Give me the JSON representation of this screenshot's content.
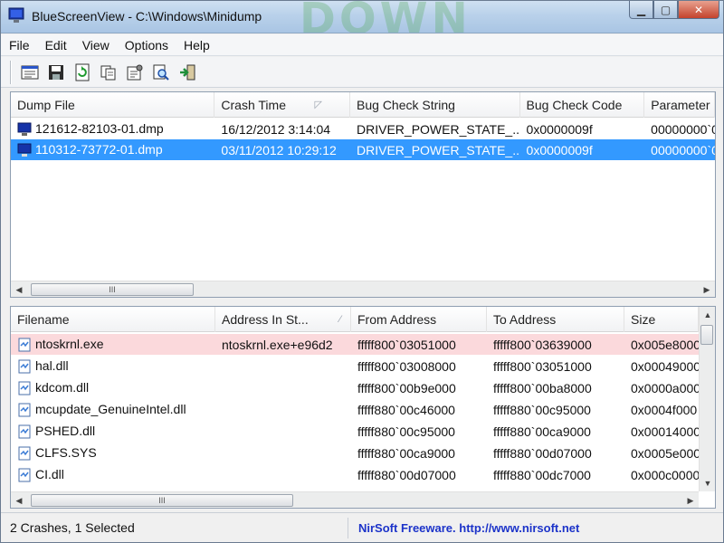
{
  "window": {
    "title": "BlueScreenView  -  C:\\Windows\\Minidump",
    "title_bg_text": "DOWN",
    "buttons": {
      "minimize": "▁",
      "maximize": "▢",
      "close": "✕"
    }
  },
  "menu": {
    "items": [
      "File",
      "Edit",
      "View",
      "Options",
      "Help"
    ]
  },
  "toolbar": {
    "icons": [
      "html-report-icon",
      "save-icon",
      "refresh-icon",
      "copy-icon",
      "properties-icon",
      "find-icon",
      "exit-icon"
    ]
  },
  "crash_list": {
    "columns": [
      "Dump File",
      "Crash Time",
      "Bug Check String",
      "Bug Check Code",
      "Parameter"
    ],
    "sort_glyph": "◸",
    "rows": [
      {
        "dump_file": "121612-82103-01.dmp",
        "crash_time": "16/12/2012 3:14:04",
        "bug_check_string": "DRIVER_POWER_STATE_...",
        "bug_check_code": "0x0000009f",
        "parameter": "00000000`0",
        "selected": false
      },
      {
        "dump_file": "110312-73772-01.dmp",
        "crash_time": "03/11/2012 10:29:12",
        "bug_check_string": "DRIVER_POWER_STATE_...",
        "bug_check_code": "0x0000009f",
        "parameter": "00000000`0",
        "selected": true
      }
    ],
    "scroll_thumb": "III"
  },
  "driver_list": {
    "columns": [
      "Filename",
      "Address In St...",
      "From Address",
      "To Address",
      "Size"
    ],
    "sort_glyph": "⁄",
    "rows": [
      {
        "filename": "ntoskrnl.exe",
        "address_in_stack": "ntoskrnl.exe+e96d2",
        "from": "fffff800`03051000",
        "to": "fffff800`03639000",
        "size": "0x005e8000",
        "highlight": true
      },
      {
        "filename": "hal.dll",
        "address_in_stack": "",
        "from": "fffff800`03008000",
        "to": "fffff800`03051000",
        "size": "0x00049000",
        "highlight": false
      },
      {
        "filename": "kdcom.dll",
        "address_in_stack": "",
        "from": "fffff800`00b9e000",
        "to": "fffff800`00ba8000",
        "size": "0x0000a000",
        "highlight": false
      },
      {
        "filename": "mcupdate_GenuineIntel.dll",
        "address_in_stack": "",
        "from": "fffff880`00c46000",
        "to": "fffff880`00c95000",
        "size": "0x0004f000",
        "highlight": false
      },
      {
        "filename": "PSHED.dll",
        "address_in_stack": "",
        "from": "fffff880`00c95000",
        "to": "fffff880`00ca9000",
        "size": "0x00014000",
        "highlight": false
      },
      {
        "filename": "CLFS.SYS",
        "address_in_stack": "",
        "from": "fffff880`00ca9000",
        "to": "fffff880`00d07000",
        "size": "0x0005e000",
        "highlight": false
      },
      {
        "filename": "CI.dll",
        "address_in_stack": "",
        "from": "fffff880`00d07000",
        "to": "fffff880`00dc7000",
        "size": "0x000c0000",
        "highlight": false
      }
    ],
    "scroll_thumb": "III"
  },
  "status": {
    "summary": "2 Crashes, 1 Selected",
    "link": "NirSoft Freeware.  http://www.nirsoft.net"
  },
  "colors": {
    "selection": "#3399ff",
    "highlight_row": "#fbd9dc",
    "link": "#1c33c9"
  }
}
